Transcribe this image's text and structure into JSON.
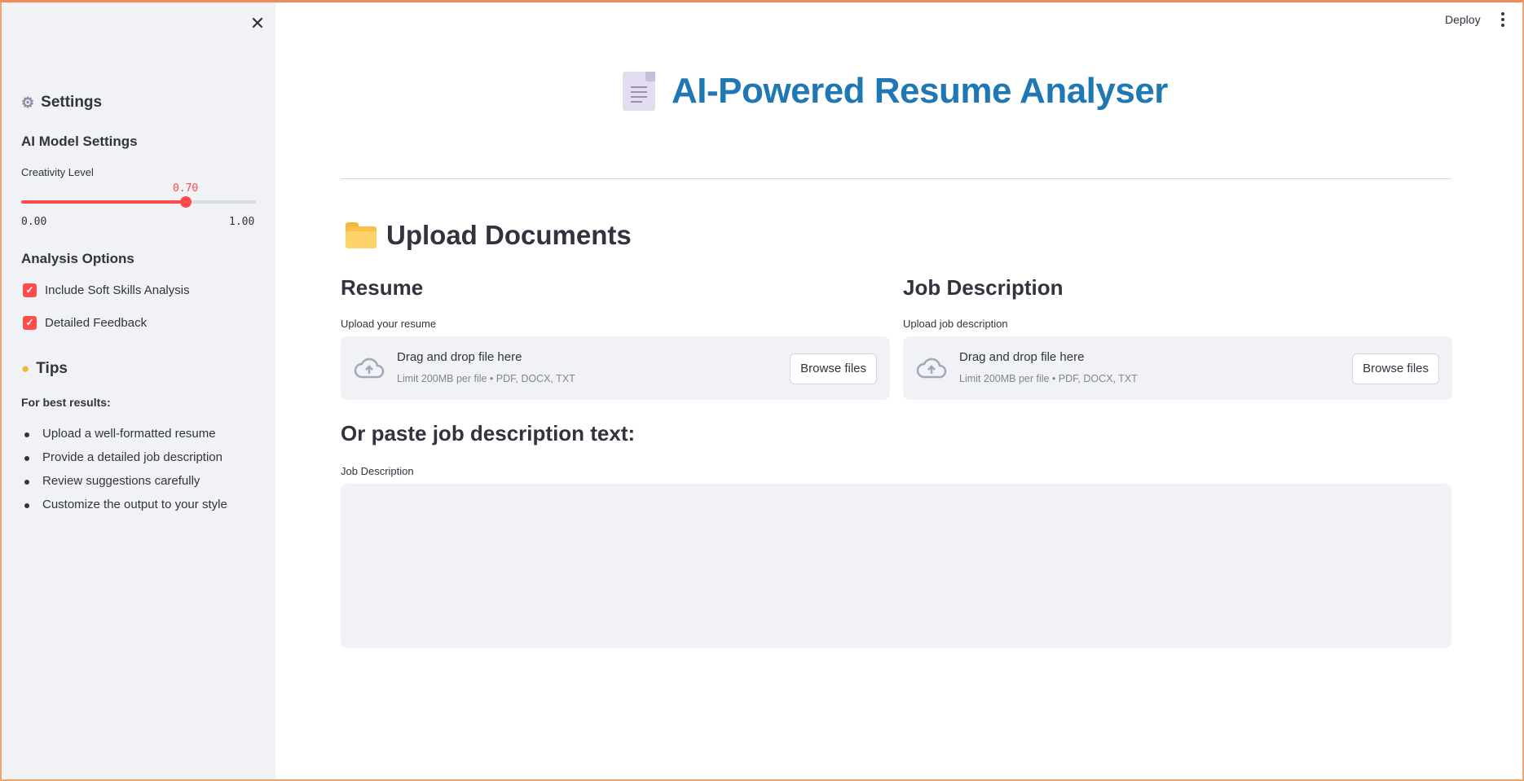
{
  "header": {
    "deploy_label": "Deploy"
  },
  "sidebar": {
    "settings_title": "Settings",
    "model_settings_title": "AI Model Settings",
    "slider": {
      "label": "Creativity Level",
      "value": 0.7,
      "value_text": "0.70",
      "min_text": "0.00",
      "max_text": "1.00"
    },
    "analysis_title": "Analysis Options",
    "options": [
      {
        "label": "Include Soft Skills Analysis",
        "checked": true
      },
      {
        "label": "Detailed Feedback",
        "checked": true
      }
    ],
    "tips_title": "Tips",
    "tips_subtitle": "For best results:",
    "tips": [
      "Upload a well-formatted resume",
      "Provide a detailed job description",
      "Review suggestions carefully",
      "Customize the output to your style"
    ]
  },
  "main": {
    "title": "AI-Powered Resume Analyser",
    "upload_title": "Upload Documents",
    "resume": {
      "heading": "Resume",
      "label": "Upload your resume",
      "drop_title": "Drag and drop file here",
      "drop_sub": "Limit 200MB per file • PDF, DOCX, TXT",
      "browse": "Browse files"
    },
    "job": {
      "heading": "Job Description",
      "label": "Upload job description",
      "drop_title": "Drag and drop file here",
      "drop_sub": "Limit 200MB per file • PDF, DOCX, TXT",
      "browse": "Browse files"
    },
    "paste_heading": "Or paste job description text:",
    "paste_label": "Job Description",
    "paste_value": ""
  },
  "colors": {
    "accent": "#ff4b4b",
    "title": "#1f77b4",
    "sidebar_bg": "#f0f2f6"
  },
  "icons": {
    "close": "close-icon",
    "settings": "gear-icon",
    "tips": "lightbulb-icon",
    "doc": "document-icon",
    "folder": "folder-icon",
    "upload": "cloud-upload-icon",
    "menu": "kebab-menu-icon"
  }
}
